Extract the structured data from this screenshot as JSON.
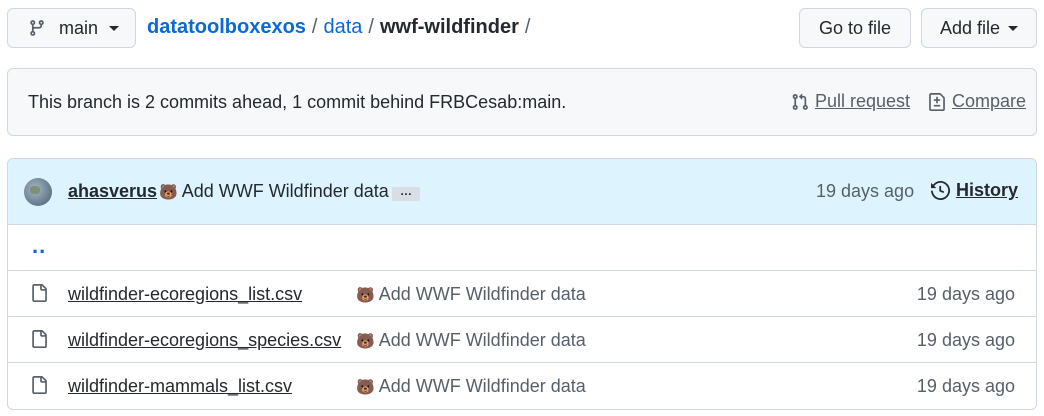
{
  "branch": {
    "name": "main",
    "icon": "git-branch-icon"
  },
  "breadcrumb": {
    "repo": "datatoolboxexos",
    "folder": "data",
    "current": "wwf-wildfinder",
    "separator": "/"
  },
  "actions": {
    "go_to_file": "Go to file",
    "add_file": "Add file"
  },
  "branch_info": {
    "text": "This branch is 2 commits ahead, 1 commit behind FRBCesab:main.",
    "pull_request": "Pull request",
    "compare": "Compare"
  },
  "latest_commit": {
    "author": "ahasverus",
    "emoji": "🐻",
    "message": "Add WWF Wildfinder data",
    "ellipsis": "…",
    "time": "19 days ago",
    "history": "History"
  },
  "parent_dir": "..",
  "files": [
    {
      "name": "wildfinder-ecoregions_list.csv",
      "emoji": "🐻",
      "message": "Add WWF Wildfinder data",
      "time": "19 days ago"
    },
    {
      "name": "wildfinder-ecoregions_species.csv",
      "emoji": "🐻",
      "message": "Add WWF Wildfinder data",
      "time": "19 days ago"
    },
    {
      "name": "wildfinder-mammals_list.csv",
      "emoji": "🐻",
      "message": "Add WWF Wildfinder data",
      "time": "19 days ago"
    }
  ],
  "colors": {
    "link": "#0969da",
    "muted": "#57606a",
    "commit_bg": "#ddf4ff",
    "border": "#d0d7de"
  }
}
